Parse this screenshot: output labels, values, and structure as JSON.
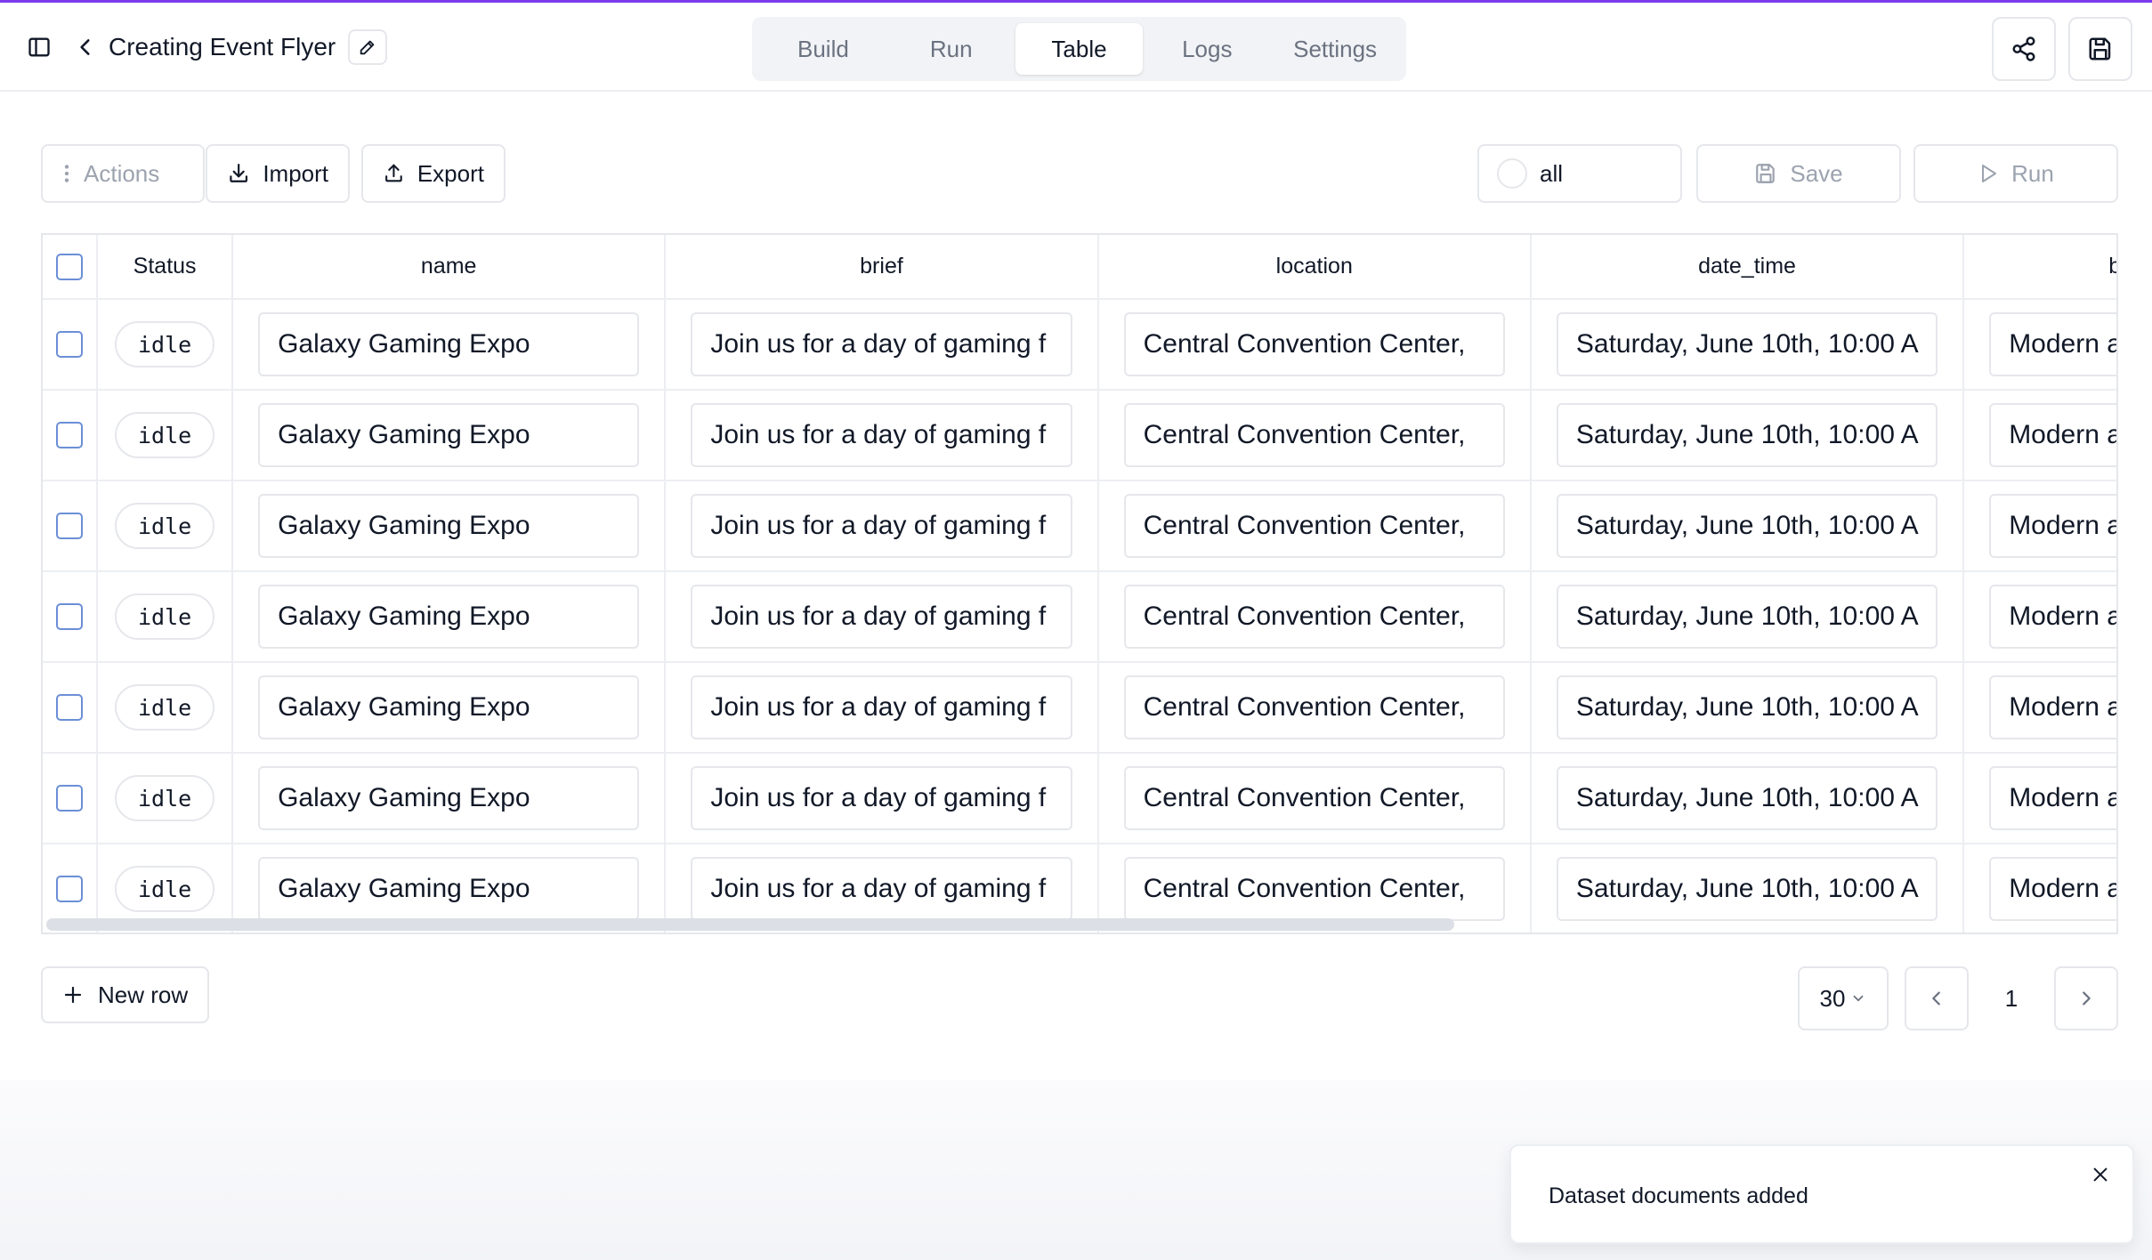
{
  "header": {
    "title": "Creating Event Flyer",
    "tabs": [
      {
        "label": "Build",
        "active": false
      },
      {
        "label": "Run",
        "active": false
      },
      {
        "label": "Table",
        "active": true
      },
      {
        "label": "Logs",
        "active": false
      },
      {
        "label": "Settings",
        "active": false
      }
    ],
    "icons": {
      "sidebar": "sidebar-toggle-icon",
      "back": "chevron-left-icon",
      "edit": "pencil-icon",
      "share": "share-icon",
      "save": "floppy-disk-icon"
    }
  },
  "toolbar": {
    "actions_label": "Actions",
    "import_label": "Import",
    "export_label": "Export",
    "filter_label": "all",
    "save_label": "Save",
    "run_label": "Run"
  },
  "table": {
    "columns": [
      "Status",
      "name",
      "brief",
      "location",
      "date_time",
      "brand_colc"
    ],
    "rows": [
      {
        "status": "idle",
        "name": "Galaxy Gaming Expo",
        "brief": "Join us for a day of gaming f",
        "location": "Central Convention Center,",
        "date_time": "Saturday, June 10th, 10:00 A",
        "brand": "Modern and sleek"
      },
      {
        "status": "idle",
        "name": "Galaxy Gaming Expo",
        "brief": "Join us for a day of gaming f",
        "location": "Central Convention Center,",
        "date_time": "Saturday, June 10th, 10:00 A",
        "brand": "Modern and sleek"
      },
      {
        "status": "idle",
        "name": "Galaxy Gaming Expo",
        "brief": "Join us for a day of gaming f",
        "location": "Central Convention Center,",
        "date_time": "Saturday, June 10th, 10:00 A",
        "brand": "Modern and sleek"
      },
      {
        "status": "idle",
        "name": "Galaxy Gaming Expo",
        "brief": "Join us for a day of gaming f",
        "location": "Central Convention Center,",
        "date_time": "Saturday, June 10th, 10:00 A",
        "brand": "Modern and sleek"
      },
      {
        "status": "idle",
        "name": "Galaxy Gaming Expo",
        "brief": "Join us for a day of gaming f",
        "location": "Central Convention Center,",
        "date_time": "Saturday, June 10th, 10:00 A",
        "brand": "Modern and sleek"
      },
      {
        "status": "idle",
        "name": "Galaxy Gaming Expo",
        "brief": "Join us for a day of gaming f",
        "location": "Central Convention Center,",
        "date_time": "Saturday, June 10th, 10:00 A",
        "brand": "Modern and sleek"
      },
      {
        "status": "idle",
        "name": "Galaxy Gaming Expo",
        "brief": "Join us for a day of gaming f",
        "location": "Central Convention Center,",
        "date_time": "Saturday, June 10th, 10:00 A",
        "brand": "Modern and sleek"
      }
    ]
  },
  "footer": {
    "new_row_label": "New row",
    "page_size": "30",
    "current_page": "1"
  },
  "toast": {
    "message": "Dataset documents added"
  },
  "colors": {
    "accent": "#7c3aed",
    "border": "#e5e7eb",
    "checkbox": "#6b8fd6"
  }
}
